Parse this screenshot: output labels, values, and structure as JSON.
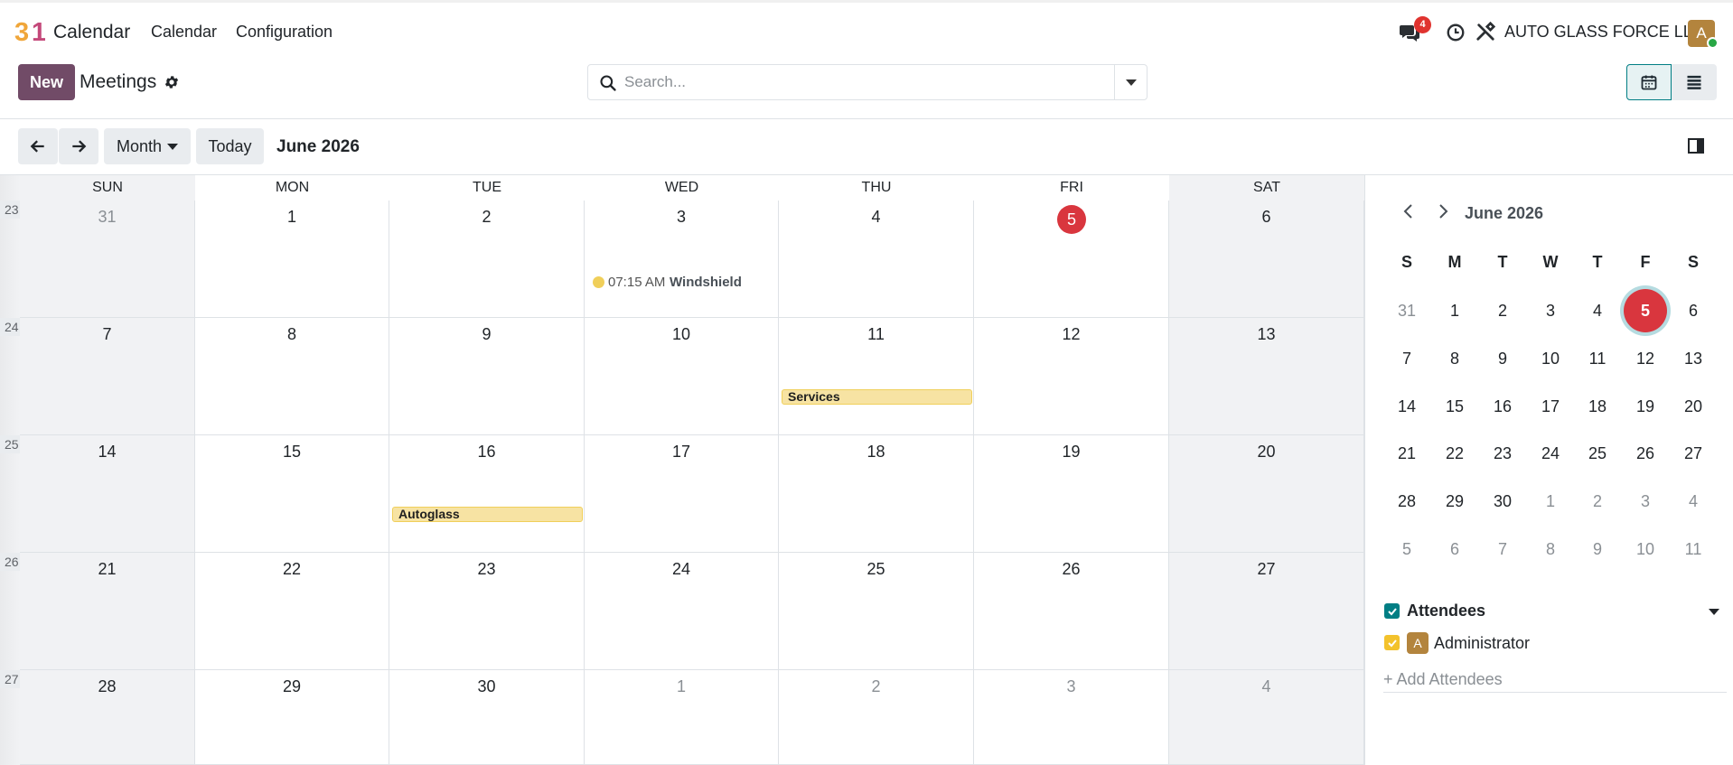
{
  "navbar": {
    "app_name": "Calendar",
    "logo_text": "31",
    "menus": [
      "Calendar",
      "Configuration"
    ],
    "messages_badge": "4",
    "company": "AUTO GLASS FORCE LLC",
    "user_initial": "A",
    "icons": [
      "discuss-icon",
      "clock-icon",
      "tools-icon"
    ]
  },
  "control_panel": {
    "new_label": "New",
    "title": "Meetings",
    "search_placeholder": "Search..."
  },
  "toolbar": {
    "scale_label": "Month",
    "today_label": "Today",
    "period_title": "June 2026"
  },
  "calendar": {
    "weekdays": [
      "SUN",
      "MON",
      "TUE",
      "WED",
      "THU",
      "FRI",
      "SAT"
    ],
    "week_numbers": [
      "23",
      "24",
      "25",
      "26",
      "27"
    ],
    "weeks": [
      [
        "31",
        "1",
        "2",
        "3",
        "4",
        "5",
        "6"
      ],
      [
        "7",
        "8",
        "9",
        "10",
        "11",
        "12",
        "13"
      ],
      [
        "14",
        "15",
        "16",
        "17",
        "18",
        "19",
        "20"
      ],
      [
        "21",
        "22",
        "23",
        "24",
        "25",
        "26",
        "27"
      ],
      [
        "28",
        "29",
        "30",
        "1",
        "2",
        "3",
        "4"
      ]
    ],
    "today": "5",
    "events": {
      "windshield_time": "07:15 AM",
      "windshield_title": "Windshield",
      "services": "Services",
      "autoglass": "Autoglass"
    },
    "event_color": "#f0cf5a",
    "today_color": "#d9363e"
  },
  "sidebar": {
    "mini_title": "June 2026",
    "mini_dow": [
      "S",
      "M",
      "T",
      "W",
      "T",
      "F",
      "S"
    ],
    "mini_weeks": [
      [
        "31",
        "1",
        "2",
        "3",
        "4",
        "5",
        "6"
      ],
      [
        "7",
        "8",
        "9",
        "10",
        "11",
        "12",
        "13"
      ],
      [
        "14",
        "15",
        "16",
        "17",
        "18",
        "19",
        "20"
      ],
      [
        "21",
        "22",
        "23",
        "24",
        "25",
        "26",
        "27"
      ],
      [
        "28",
        "29",
        "30",
        "1",
        "2",
        "3",
        "4"
      ],
      [
        "5",
        "6",
        "7",
        "8",
        "9",
        "10",
        "11"
      ]
    ],
    "filter_title": "Attendees",
    "attendee_initial": "A",
    "attendee_name": "Administrator",
    "add_attendees": "+ Add Attendees"
  }
}
